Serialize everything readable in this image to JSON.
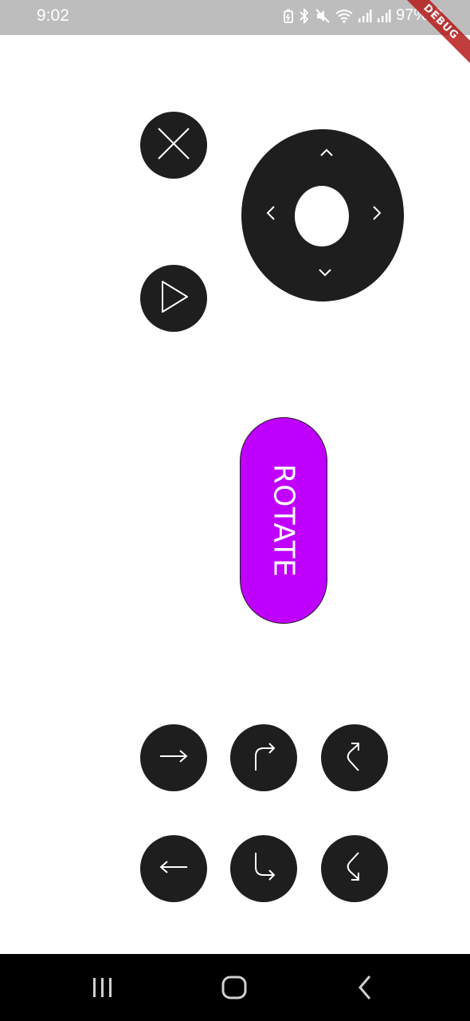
{
  "status_bar": {
    "time": "9:02",
    "battery": "97%",
    "icons": [
      "battery-saver-icon",
      "bluetooth-icon",
      "mute-icon",
      "wifi-icon",
      "signal-icon",
      "signal-icon",
      "battery-icon"
    ]
  },
  "debug_banner": {
    "label": "DEBUG"
  },
  "controls": {
    "close_button": {
      "icon": "close-icon"
    },
    "play_button": {
      "icon": "play-icon"
    },
    "dpad": {
      "up": "chevron-up-icon",
      "down": "chevron-down-icon",
      "left": "chevron-left-icon",
      "right": "chevron-right-icon"
    },
    "rotate_button": {
      "label": "ROTATE",
      "color": "#bf00ff"
    },
    "arrow_buttons": [
      {
        "icon": "arrow-right-icon"
      },
      {
        "icon": "turn-right-icon"
      },
      {
        "icon": "rotate-clockwise-icon"
      },
      {
        "icon": "arrow-left-icon"
      },
      {
        "icon": "turn-down-right-icon"
      },
      {
        "icon": "rotate-counterclockwise-icon"
      }
    ]
  },
  "nav_bar": {
    "items": [
      "recent-apps-icon",
      "home-icon",
      "back-icon"
    ]
  },
  "colors": {
    "button_bg": "#1f1e1f",
    "status_bar_bg": "#bdbdbd",
    "accent": "#bf00ff"
  }
}
